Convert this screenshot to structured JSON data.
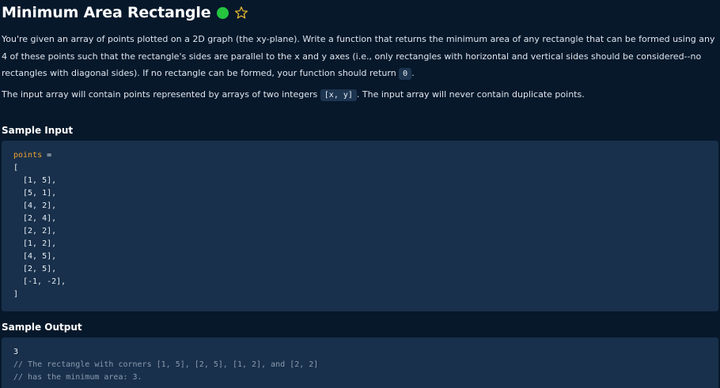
{
  "header": {
    "title": "Minimum Area Rectangle",
    "status_color": "#25c540",
    "star_icon": "star-outline-icon",
    "star_color": "#f2c230"
  },
  "description": {
    "p1_text": "You're given an array of points plotted on a 2D graph (the xy-plane). Write a function that returns the minimum area of any rectangle that can be formed using any 4 of these points such that the rectangle's sides are parallel to the x and y axes (i.e., only rectangles with horizontal and vertical sides should be considered--no rectangles with diagonal sides). If no rectangle can be formed, your function should return ",
    "p1_code": "0",
    "p1_end": ".",
    "p2_start": "The input array will contain points represented by arrays of two integers ",
    "p2_code": "[x, y]",
    "p2_end": ". The input array will never contain duplicate points."
  },
  "sample_input": {
    "label": "Sample Input",
    "var_name": "points",
    "assign": " =",
    "open": "[",
    "points": [
      "[1, 5],",
      "[5, 1],",
      "[4, 2],",
      "[2, 4],",
      "[2, 2],",
      "[1, 2],",
      "[4, 5],",
      "[2, 5],",
      "[-1, -2],"
    ],
    "close": "]"
  },
  "sample_output": {
    "label": "Sample Output",
    "value": "3",
    "comment_1": "// The rectangle with corners [1, 5], [2, 5], [1, 2], and [2, 2]",
    "comment_2": "// has the minimum area: 3."
  }
}
